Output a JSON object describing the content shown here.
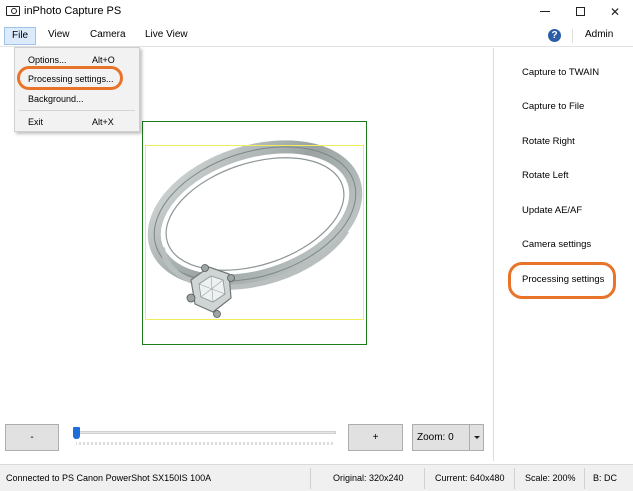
{
  "window": {
    "title": "inPhoto Capture PS",
    "controls": [
      "minimize",
      "maximize",
      "close"
    ]
  },
  "menubar": {
    "file": "File",
    "view": "View",
    "camera": "Camera",
    "live_view": "Live View",
    "help_icon": "?",
    "admin": "Admin"
  },
  "file_menu": {
    "items": [
      {
        "label": "Options...",
        "shortcut": "Alt+O"
      },
      {
        "label": "Processing settings...",
        "shortcut": ""
      },
      {
        "label": "Background...",
        "shortcut": ""
      },
      {
        "label": "Exit",
        "shortcut": "Alt+X"
      }
    ]
  },
  "sidebar": {
    "items": [
      {
        "label": "Capture to TWAIN"
      },
      {
        "label": "Capture to File"
      },
      {
        "label": "Rotate Right"
      },
      {
        "label": "Rotate Left"
      },
      {
        "label": "Update AE/AF"
      },
      {
        "label": "Camera settings"
      },
      {
        "label": "Processing settings"
      }
    ]
  },
  "controls": {
    "zoom_out_label": "-",
    "zoom_in_label": "+",
    "zoom_value": "Zoom: 0",
    "slider_level": 0.0
  },
  "statusbar": {
    "connection": "Connected to PS Canon PowerShot SX150IS 100A",
    "original": "Original: 320x240",
    "current": "Current: 640x480",
    "scale": "Scale: 200%",
    "bd": "B: DC"
  },
  "colors": {
    "highlight": "#e8742a",
    "preview_border": "#1e7a1e",
    "crop_border": "#f0ec5a",
    "slider_thumb": "#1e6fd9"
  },
  "icons": [
    "app-icon",
    "help-icon",
    "minimize-icon",
    "maximize-icon",
    "close-icon",
    "chevron-down-icon"
  ]
}
